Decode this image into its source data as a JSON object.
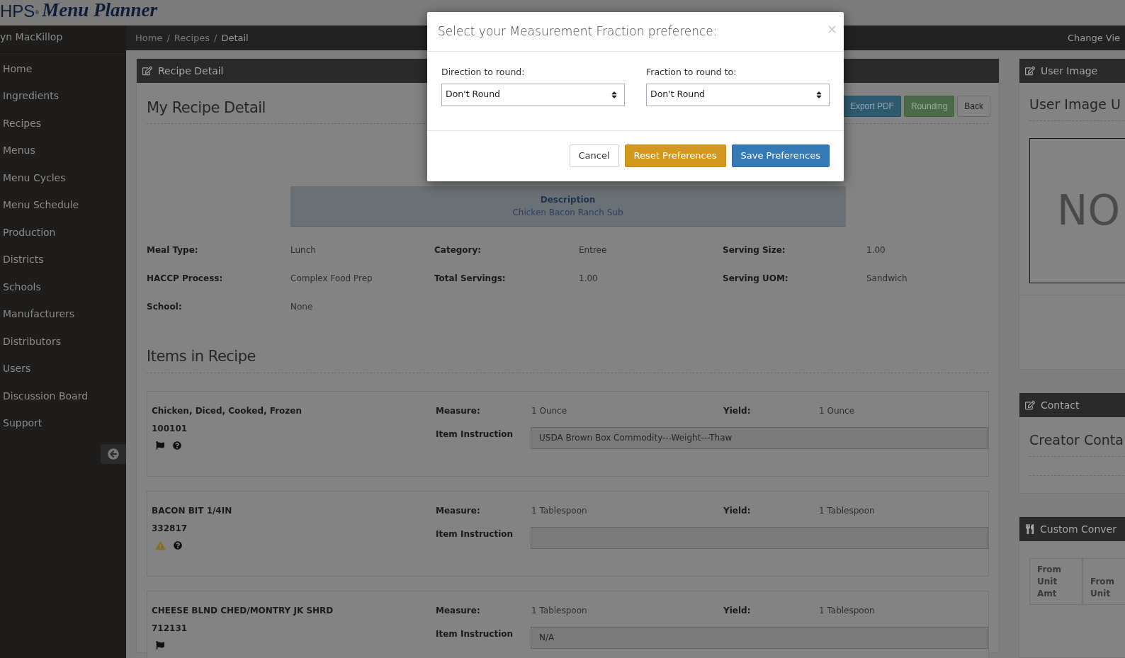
{
  "header": {
    "logo_prefix": "HPS",
    "logo_mark": "®",
    "logo_title": "Menu Planner"
  },
  "sidebar": {
    "user": "yn MacKillop",
    "items": [
      {
        "label": "Home"
      },
      {
        "label": "Ingredients"
      },
      {
        "label": "Recipes"
      },
      {
        "label": "Menus"
      },
      {
        "label": "Menu Cycles"
      },
      {
        "label": "Menu Schedule"
      },
      {
        "label": "Production"
      },
      {
        "label": "Districts"
      },
      {
        "label": "Schools"
      },
      {
        "label": "Manufacturers"
      },
      {
        "label": "Distributors"
      },
      {
        "label": "Users"
      },
      {
        "label": "Discussion Board"
      },
      {
        "label": "Support"
      }
    ]
  },
  "breadcrumb": {
    "items": [
      {
        "label": "Home",
        "separator": "/"
      },
      {
        "label": "Recipes",
        "separator": "/"
      }
    ],
    "current": "Detail",
    "right_link": "Change Vie"
  },
  "recipe_panel": {
    "title": "Recipe Detail",
    "heading": "My Recipe Detail",
    "buttons": [
      {
        "label": "Export PDF",
        "kind": "info"
      },
      {
        "label": "Rounding",
        "kind": "success"
      },
      {
        "label": "Back",
        "kind": "default"
      }
    ],
    "description": {
      "label": "Description",
      "value": "Chicken Bacon Ranch Sub"
    },
    "fields": [
      {
        "label": "Meal Type:",
        "value": "Lunch"
      },
      {
        "label": "Category:",
        "value": "Entree"
      },
      {
        "label": "Serving Size:",
        "value": "1.00"
      },
      {
        "label": "HACCP Process:",
        "value": "Complex Food Prep"
      },
      {
        "label": "Total Servings:",
        "value": "1.00"
      },
      {
        "label": "Serving UOM:",
        "value": "Sandwich"
      },
      {
        "label": "School:",
        "value": "None"
      }
    ],
    "items_heading": "Items in Recipe",
    "items": [
      {
        "name": "Chicken, Diced, Cooked, Frozen",
        "code": "100101",
        "icons": [
          {
            "kind": "flag"
          },
          {
            "kind": "help"
          }
        ],
        "measure_label": "Measure:",
        "measure": "1 Ounce",
        "yield_label": "Yield:",
        "yield": "1 Ounce",
        "instruction_label": "Item Instruction",
        "instruction": "USDA Brown Box Commodity---Weight---Thaw"
      },
      {
        "name": "BACON BIT 1/4IN",
        "code": "332817",
        "icons": [
          {
            "kind": "warning"
          },
          {
            "kind": "help"
          }
        ],
        "measure_label": "Measure:",
        "measure": "1 Tablespoon",
        "yield_label": "Yield:",
        "yield": "1 Tablespoon",
        "instruction_label": "Item Instruction"
      },
      {
        "name": "CHEESE BLND CHED/MONTRY JK SHRD",
        "code": "712131",
        "icons": [
          {
            "kind": "flag"
          }
        ],
        "measure_label": "Measure:",
        "measure": "1 Tablespoon",
        "yield_label": "Yield:",
        "yield": "1 Tablespoon",
        "instruction_label": "Item Instruction",
        "instruction": "N/A"
      }
    ]
  },
  "side_panels": {
    "user_image": {
      "title": "User Image",
      "heading": "User Image U",
      "placeholder_text": "NO"
    },
    "contact": {
      "title": "Contact",
      "heading": "Creator Conta"
    },
    "conversions": {
      "title": "Custom Conver",
      "columns": [
        "From Unit Amt",
        "From Unit"
      ]
    }
  },
  "modal": {
    "title": "Select your Measurement Fraction preference:",
    "close": "×",
    "selects": [
      {
        "label": "Direction to round:",
        "value": "Don't Round"
      },
      {
        "label": "Fraction to round to:",
        "value": "Don't Round"
      }
    ],
    "buttons": [
      {
        "label": "Cancel",
        "kind": "default"
      },
      {
        "label": "Reset Preferences",
        "kind": "warning"
      },
      {
        "label": "Save Preferences",
        "kind": "primary"
      }
    ]
  }
}
